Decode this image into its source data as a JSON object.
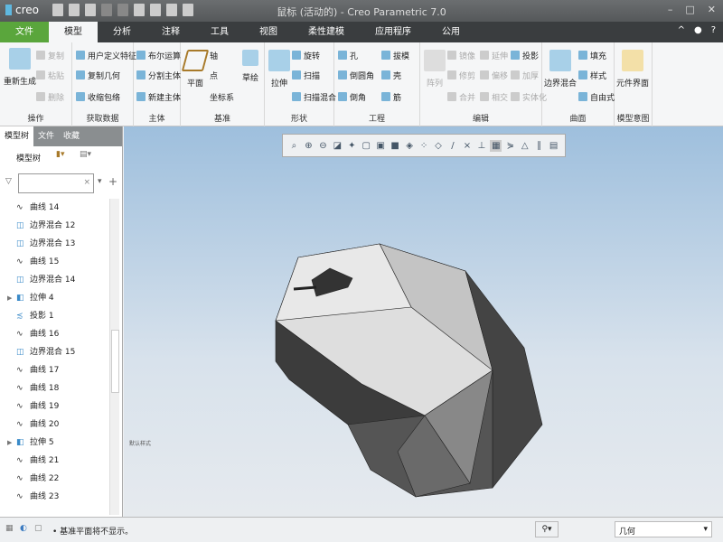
{
  "titlebar": {
    "logo": "creo",
    "title": "鼠标 (活动的) - Creo Parametric 7.0",
    "min": "–",
    "max": "□",
    "close": "✕"
  },
  "tabs": [
    "文件",
    "模型",
    "分析",
    "注释",
    "工具",
    "视图",
    "柔性建模",
    "应用程序",
    "公用"
  ],
  "help": {
    "collapse": "^",
    "light": "●",
    "help": "?"
  },
  "ribbon": {
    "operations": {
      "regen": "重新生成",
      "copy": "复制",
      "paste": "粘贴",
      "delete": "删除",
      "label": "操作"
    },
    "getdata": {
      "udf": "用户定义特征",
      "copygeom": "复制几何",
      "shrinkwrap": "收缩包络",
      "label": "获取数据"
    },
    "body": {
      "boolean": "布尔运算",
      "split": "分割主体",
      "newbody": "新建主体",
      "label": "主体"
    },
    "datum": {
      "plane": "平面",
      "axis": "轴",
      "point": "点",
      "csys": "坐标系",
      "sketch": "草绘",
      "label": "基准"
    },
    "shape": {
      "extrude": "拉伸",
      "revolve": "旋转",
      "sweep": "扫描",
      "sweptblend": "扫描混合",
      "label": "形状"
    },
    "engineering": {
      "hole": "孔",
      "round": "倒圆角",
      "chamfer": "倒角",
      "draft": "拔模",
      "shell": "壳",
      "rib": "筋",
      "label": "工程"
    },
    "editing": {
      "pattern": "阵列",
      "mirror": "镜像",
      "extend": "延伸",
      "project": "投影",
      "trim": "修剪",
      "offset": "偏移",
      "thicken": "加厚",
      "merge": "合并",
      "intersect": "相交",
      "solidify": "实体化",
      "label": "编辑"
    },
    "surfaces": {
      "boundary": "边界混合",
      "fill": "填充",
      "style": "样式",
      "freestyle": "自由式",
      "label": "曲面"
    },
    "intent": {
      "component": "元件界面",
      "label": "模型意图"
    }
  },
  "sidebar": {
    "tabs": [
      "模型树",
      "文件",
      "收藏"
    ],
    "tree_label": "模型树",
    "filter_clear": "×",
    "items": [
      {
        "icon": "curve",
        "label": "曲线 14"
      },
      {
        "icon": "boundary",
        "label": "边界混合 12"
      },
      {
        "icon": "boundary",
        "label": "边界混合 13"
      },
      {
        "icon": "curve",
        "label": "曲线 15"
      },
      {
        "icon": "boundary",
        "label": "边界混合 14"
      },
      {
        "icon": "extrude",
        "label": "拉伸 4",
        "expandable": true
      },
      {
        "icon": "project",
        "label": "投影 1"
      },
      {
        "icon": "curve",
        "label": "曲线 16"
      },
      {
        "icon": "boundary",
        "label": "边界混合 15"
      },
      {
        "icon": "curve",
        "label": "曲线 17"
      },
      {
        "icon": "curve",
        "label": "曲线 18"
      },
      {
        "icon": "curve",
        "label": "曲线 19"
      },
      {
        "icon": "curve",
        "label": "曲线 20"
      },
      {
        "icon": "extrude",
        "label": "拉伸 5",
        "expandable": true
      },
      {
        "icon": "curve",
        "label": "曲线 21"
      },
      {
        "icon": "curve",
        "label": "曲线 22"
      },
      {
        "icon": "curve",
        "label": "曲线 23"
      }
    ]
  },
  "viewport": {
    "label": "默认样式"
  },
  "status": {
    "message": "• 基准平面将不显示。",
    "filter": "几何"
  }
}
